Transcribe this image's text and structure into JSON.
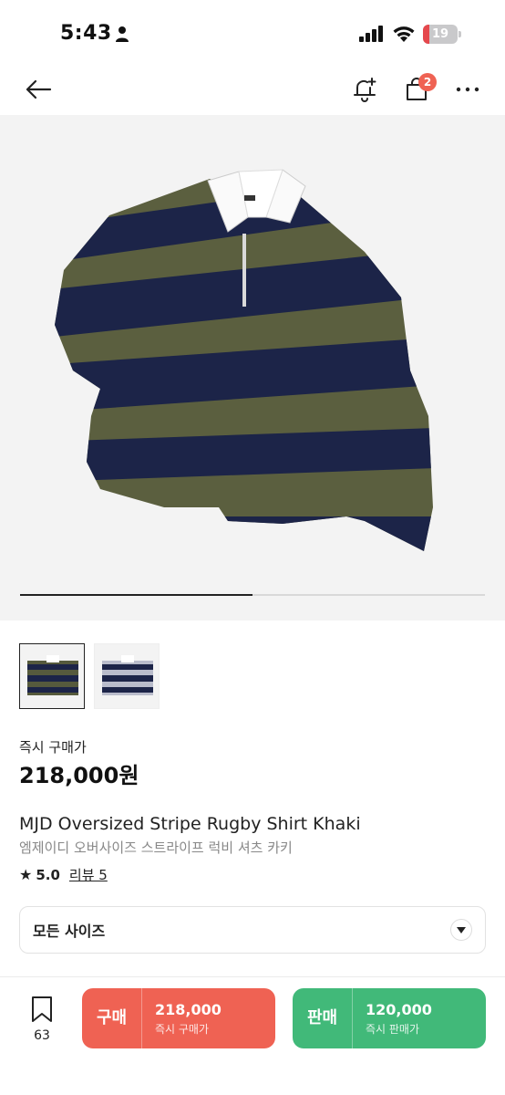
{
  "status_bar": {
    "time": "5:43",
    "battery": "19",
    "battery_level": 0.19,
    "battery_color": "#e5484d"
  },
  "nav": {
    "back_icon": "arrow-left-icon",
    "bell_icon": "bell-plus-icon",
    "bag_icon": "shopping-bag-icon",
    "more_icon": "more-horizontal-icon",
    "cart_badge": "2"
  },
  "gallery": {
    "progress": 0.5,
    "thumbnails": [
      {
        "name": "khaki-navy",
        "selected": true
      },
      {
        "name": "grey-navy",
        "selected": false
      }
    ]
  },
  "price": {
    "label": "즉시 구매가",
    "value": "218,000원"
  },
  "product": {
    "name": "MJD Oversized Stripe Rugby Shirt Khaki",
    "name_ko": "엠제이디 오버사이즈 스트라이프 럭비 셔츠 카키",
    "rating": "5.0",
    "review_label": "리뷰 5"
  },
  "size_select": {
    "label": "모든 사이즈"
  },
  "bottom_bar": {
    "bookmark_count": "63",
    "buy": {
      "label": "구매",
      "price": "218,000",
      "sub": "즉시 구매가",
      "color": "#ef6253"
    },
    "sell": {
      "label": "판매",
      "price": "120,000",
      "sub": "즉시 판매가",
      "color": "#41b979"
    }
  }
}
